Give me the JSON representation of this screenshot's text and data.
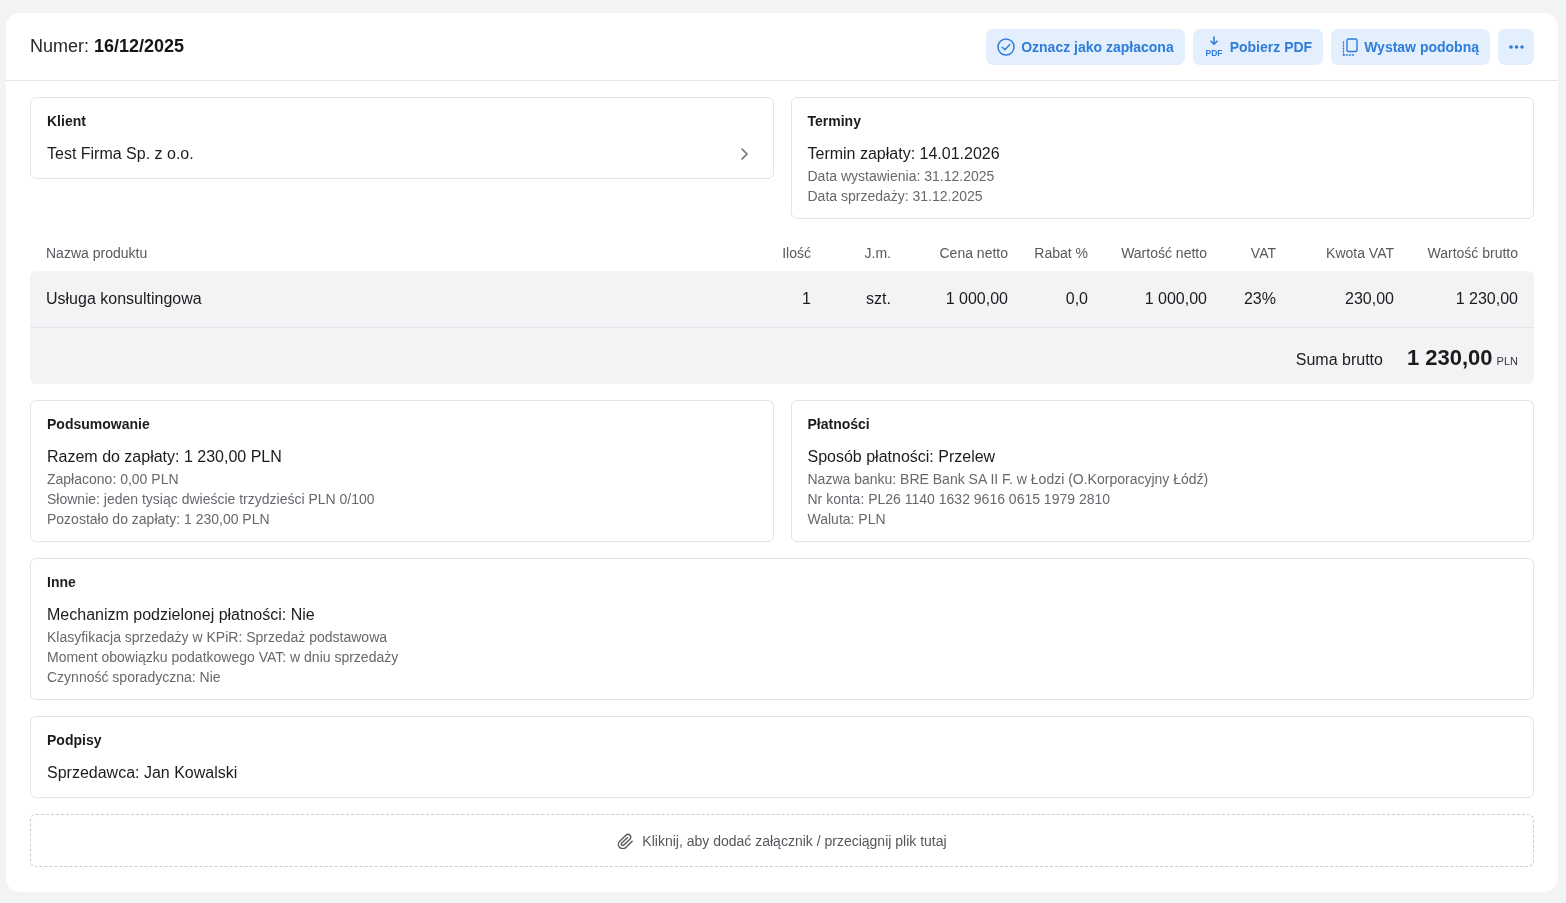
{
  "header": {
    "number": "Numer: **16/12/2025**",
    "actions": [
      {
        "kind": "mark_paid",
        "label": "Oznacz jako zapłacona"
      },
      {
        "kind": "pdf",
        "label": "Pobierz PDF",
        "icon_label": "PDF"
      },
      {
        "kind": "duplicate",
        "label": "Wystaw podobną"
      },
      {
        "kind": "more"
      }
    ]
  },
  "top_cards": [
    {
      "kind": "link",
      "title": "Klient",
      "main": "Test Firma Sp. z o.o."
    },
    {
      "kind": "info",
      "title": "Terminy",
      "main": "Termin zapłaty: 14.01.2026",
      "details": [
        "Data wystawienia: 31.12.2025",
        "Data sprzedaży: 31.12.2025"
      ]
    }
  ],
  "table": {
    "columns": [
      "Nazwa produktu",
      "Ilość",
      "J.m.",
      "Cena netto",
      "Rabat %",
      "Wartość netto",
      "VAT",
      "Kwota VAT",
      "Wartość brutto"
    ],
    "rows": [
      {
        "cells": [
          "Usługa konsultingowa",
          "1",
          "szt.",
          "1 000,00",
          "0,0",
          "1 000,00",
          "23%",
          "230,00",
          "1 230,00"
        ]
      }
    ],
    "total": {
      "label": "Suma brutto",
      "amount": "1 230,00",
      "currency": "PLN"
    }
  },
  "summary_cards": [
    {
      "title": "Podsumowanie",
      "main": "Razem do zapłaty: 1 230,00 PLN",
      "details": [
        "Zapłacono: 0,00 PLN",
        "Słownie: jeden tysiąc dwieście trzydzieści PLN 0/100",
        "Pozostało do zapłaty: 1 230,00 PLN"
      ]
    },
    {
      "title": "Płatności",
      "main": "Sposób płatności: Przelew",
      "details": [
        "Nazwa banku: BRE Bank SA II F. w Łodzi (O.Korporacyjny Łódź)",
        "Nr konta: PL26 1140 1632 9616 0615 1979 2810",
        "Waluta: PLN"
      ]
    }
  ],
  "wide_cards": [
    {
      "title": "Inne",
      "main": "Mechanizm podzielonej płatności: Nie",
      "details": [
        "Klasyfikacja sprzedaży w KPiR: Sprzedaż podstawowa",
        "Moment obowiązku podatkowego VAT: w dniu sprzedaży",
        "Czynność sporadyczna: Nie"
      ]
    },
    {
      "title": "Podpisy",
      "main": "Sprzedawca: Jan Kowalski"
    }
  ],
  "attachment_zone": {
    "text": "Kliknij, aby dodać załącznik / przeciągnij plik tutaj"
  }
}
